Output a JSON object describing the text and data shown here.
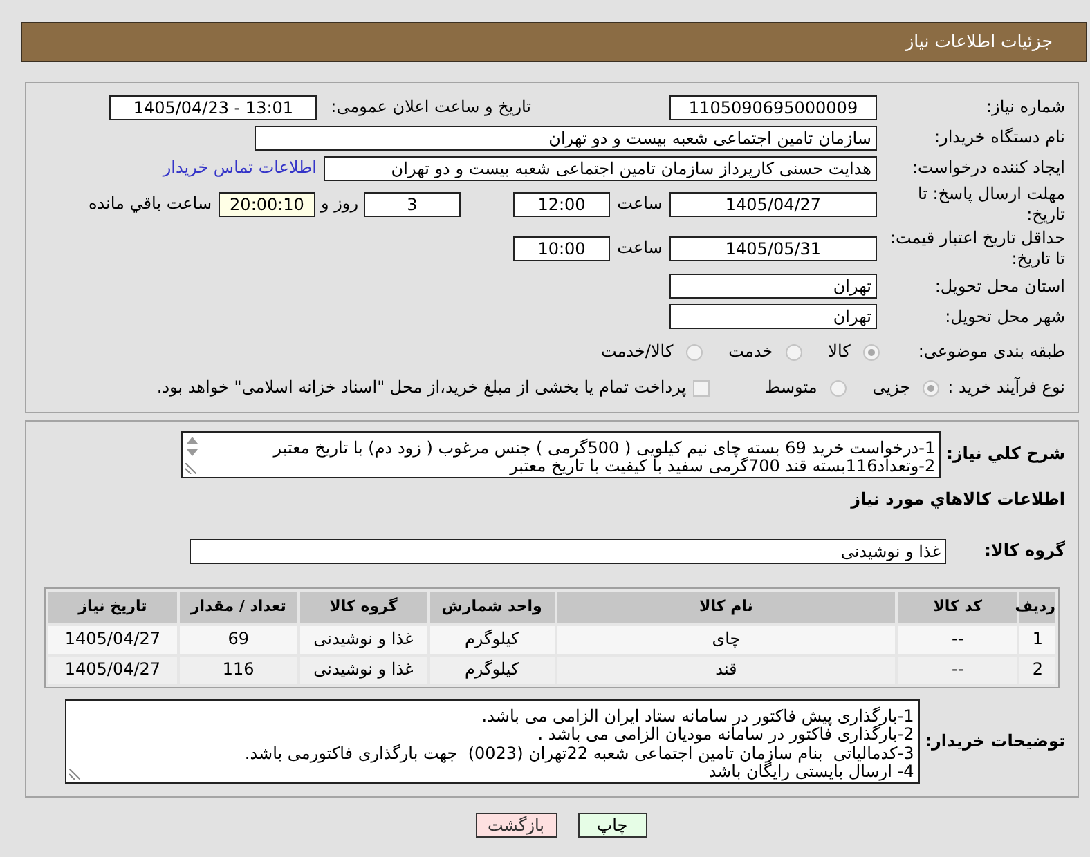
{
  "header": {
    "title": "جزئیات اطلاعات نیاز"
  },
  "details": {
    "need_number": {
      "label": "شماره نیاز:",
      "value": "1105090695000009"
    },
    "announce": {
      "label": "تاریخ و ساعت اعلان عمومی:",
      "value": "1405/04/23 - 13:01"
    },
    "buyer": {
      "label": "نام دستگاه خریدار:",
      "value": "سازمان تامین اجتماعی شعبه بیست و دو تهران"
    },
    "creator": {
      "label": "ایجاد کننده درخواست:",
      "value": "هدایت حسنی کارپرداز سازمان تامین اجتماعی شعبه بیست و دو تهران",
      "link": "اطلاعات تماس خریدار"
    },
    "deadline": {
      "label": "مهلت ارسال پاسخ: تا تاریخ:",
      "date": "1405/04/27",
      "time_label": "ساعت",
      "time": "12:00",
      "days": "3",
      "days_label": "روز و",
      "remaining": "20:00:10",
      "remaining_label": "ساعت باقي مانده"
    },
    "validity": {
      "label": "حداقل تاریخ اعتبار قیمت: تا تاریخ:",
      "date": "1405/05/31",
      "time_label": "ساعت",
      "time": "10:00"
    },
    "province": {
      "label": "استان محل تحویل:",
      "value": "تهران"
    },
    "city": {
      "label": "شهر محل تحویل:",
      "value": "تهران"
    },
    "category": {
      "label": "طبقه بندی موضوعی:",
      "options": [
        {
          "label": "کالا",
          "selected": true
        },
        {
          "label": "خدمت",
          "selected": false
        },
        {
          "label": "کالا/خدمت",
          "selected": false
        }
      ]
    },
    "process": {
      "label": "نوع فرآیند خرید :",
      "options": [
        {
          "label": "جزیی",
          "selected": true
        },
        {
          "label": "متوسط",
          "selected": false
        }
      ],
      "treasury": {
        "label": "پرداخت تمام یا بخشی از مبلغ خرید،از محل \"اسناد خزانه اسلامی\" خواهد بود.",
        "checked": false
      }
    }
  },
  "needs": {
    "description": {
      "label": "شرح کلي نیاز:",
      "lines": [
        "1-درخواست خرید 69 بسته چای نیم کیلویی ( 500گرمی ) جنس مرغوب ( زود دم) با تاریخ معتبر",
        "2-وتعداد116بسته قند 700گرمی سفید با کیفیت با تاریخ معتبر"
      ]
    },
    "goods_title": "اطلاعات کالاهاي مورد نیاز",
    "group": {
      "label": "گروه کالا:",
      "value": "غذا و نوشیدنی"
    },
    "table": {
      "columns": [
        "ردیف",
        "کد کالا",
        "نام کالا",
        "واحد شمارش",
        "گروه کالا",
        "تعداد / مقدار",
        "تاریخ نیاز"
      ],
      "rows": [
        [
          "1",
          "--",
          "چای",
          "کیلوگرم",
          "غذا و نوشیدنی",
          "69",
          "1405/04/27"
        ],
        [
          "2",
          "--",
          "قند",
          "کیلوگرم",
          "غذا و نوشیدنی",
          "116",
          "1405/04/27"
        ]
      ]
    },
    "buyer_notes": {
      "label": "توضیحات خریدار:",
      "lines": [
        "1-بارگذاری پیش فاکتور در سامانه ستاد ایران الزامی می باشد.",
        "2-بارگذاری فاکتور در سامانه مودیان الزامی می باشد .",
        "3-کدمالیاتی  بنام سازمان تامین اجتماعی شعبه 22تهران (0023)  جهت بارگذاری فاکتورمی باشد.",
        "4- ارسال بایستی رایگان باشد"
      ]
    }
  },
  "buttons": [
    {
      "label": "چاپ",
      "kind": "print"
    },
    {
      "label": "بازگشت",
      "kind": "back"
    }
  ]
}
